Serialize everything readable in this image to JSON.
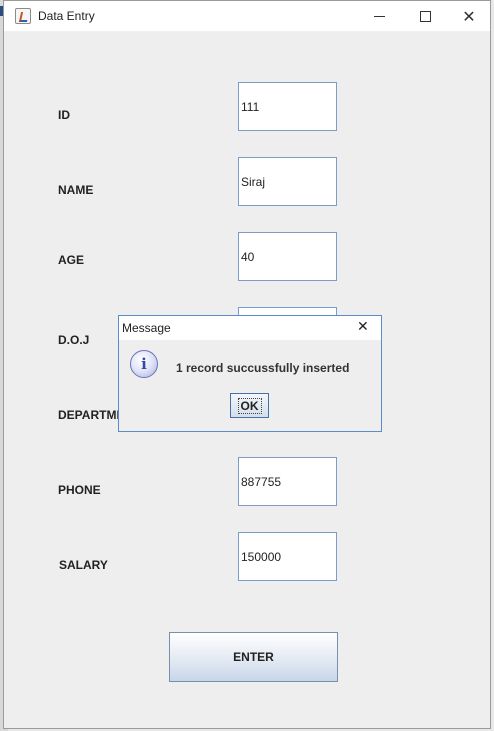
{
  "window": {
    "title": "Data Entry",
    "controls": [
      "minimize-icon",
      "maximize-icon",
      "close-icon"
    ]
  },
  "form": {
    "fields": [
      {
        "key": "id",
        "label": "ID",
        "value": "111"
      },
      {
        "key": "name",
        "label": "NAME",
        "value": "Siraj"
      },
      {
        "key": "age",
        "label": "AGE",
        "value": "40"
      },
      {
        "key": "doj",
        "label": "D.O.J",
        "value": ""
      },
      {
        "key": "department",
        "label": "DEPARTME",
        "value": ""
      },
      {
        "key": "phone",
        "label": "PHONE",
        "value": "887755"
      },
      {
        "key": "salary",
        "label": "SALARY",
        "value": "150000"
      }
    ],
    "enter_label": "ENTER"
  },
  "dialog": {
    "title": "Message",
    "close_glyph": "✕",
    "icon": "info-icon",
    "icon_glyph": "i",
    "message": "1 record succussfully inserted",
    "ok_label": "OK"
  },
  "colors": {
    "field_border": "#7a9cc6",
    "dialog_border": "#5b8cc9",
    "info_icon": "#6b73b8"
  }
}
